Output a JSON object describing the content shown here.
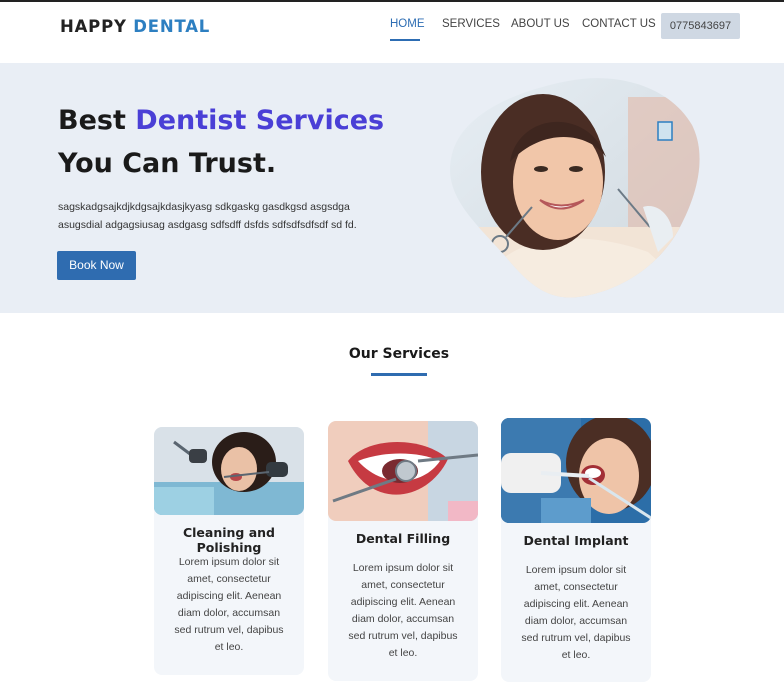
{
  "header": {
    "logo_part1": "HAPPY",
    "logo_part2": "DENTAL",
    "nav": [
      "HOME",
      "SERVICES",
      "ABOUT US",
      "CONTACT US"
    ],
    "active_nav": "HOME",
    "phone": "0775843697"
  },
  "hero": {
    "title_plain": "Best",
    "title_accent": "Dentist Services",
    "title_line2": "You Can Trust.",
    "description": "sagskadgsajkdjkdgsajkdasjkyasg sdkgaskg gasdkgsd asgsdga asugsdial adgagsiusag asdgasg sdfsdff dsfds sdfsdfsdfsdf sd fd.",
    "button": "Book Now",
    "image": "smiling-patient-photo"
  },
  "services": {
    "title": "Our Services",
    "cards": [
      {
        "title": "Cleaning and Polishing",
        "text": "Lorem ipsum dolor sit amet, consectetur adipiscing elit. Aenean diam dolor, accumsan sed rutrum vel, dapibus et leo.",
        "image": "dental-cleaning-photo"
      },
      {
        "title": "Dental Filling",
        "text": "Lorem ipsum dolor sit amet, consectetur adipiscing elit. Aenean diam dolor, accumsan sed rutrum vel, dapibus et leo.",
        "image": "dental-filling-photo"
      },
      {
        "title": "Dental Implant",
        "text": "Lorem ipsum dolor sit amet, consectetur adipiscing elit. Aenean diam dolor, accumsan sed rutrum vel, dapibus et leo.",
        "image": "dental-implant-photo"
      }
    ]
  },
  "colors": {
    "logo_accent": "#2d7fc1",
    "hero_accent": "#4a3fd6",
    "button": "#2f6cb0",
    "hero_bg": "#e9eef5",
    "card_bg": "#f3f6fa"
  }
}
